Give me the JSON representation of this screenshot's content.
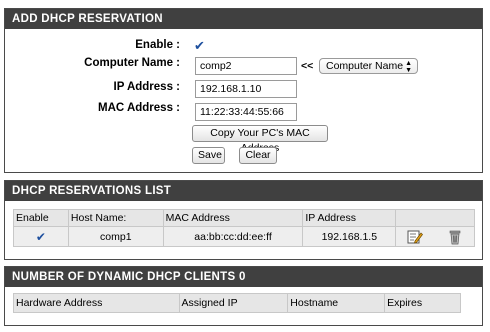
{
  "add_reservation": {
    "title": "ADD DHCP RESERVATION",
    "enable_label": "Enable :",
    "enable_checked": true,
    "computer_name_label": "Computer Name :",
    "computer_name_value": "comp2",
    "computer_name_arrow": "<<",
    "computer_name_select": "Computer Name",
    "ip_label": "IP Address :",
    "ip_value": "192.168.1.10",
    "mac_label": "MAC Address :",
    "mac_value": "11:22:33:44:55:66",
    "copy_mac_button": "Copy Your PC's MAC Address",
    "save_button": "Save",
    "clear_button": "Clear"
  },
  "reservations_list": {
    "title": "DHCP RESERVATIONS LIST",
    "columns": [
      "Enable",
      "Host Name:",
      "MAC Address",
      "IP Address"
    ],
    "rows": [
      {
        "enabled": true,
        "host": "comp1",
        "mac": "aa:bb:cc:dd:ee:ff",
        "ip": "192.168.1.5",
        "edit_icon": "edit-icon",
        "delete_icon": "trash-icon"
      }
    ]
  },
  "dynamic_clients": {
    "title": "NUMBER OF DYNAMIC DHCP CLIENTS 0",
    "columns": [
      "Hardware Address",
      "Assigned IP",
      "Hostname",
      "Expires"
    ]
  }
}
